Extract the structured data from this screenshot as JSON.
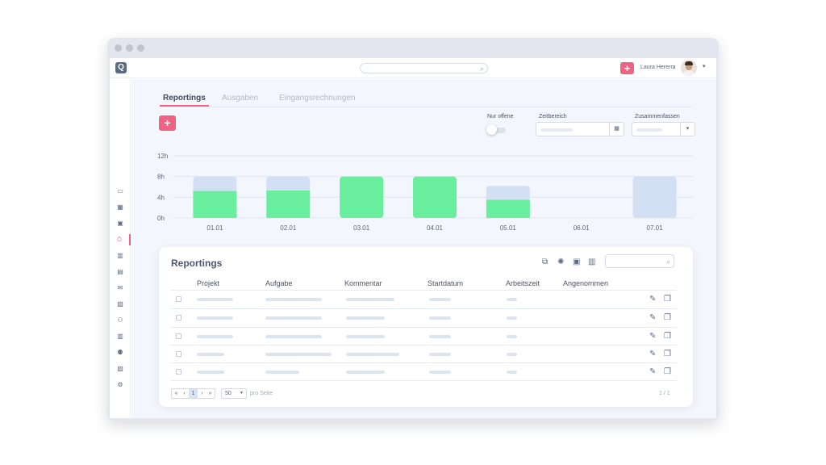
{
  "header": {
    "user_name": "Laura Hererra",
    "add_label": "+",
    "logo_label": "Q"
  },
  "tabs": [
    {
      "label": "Reportings",
      "active": true
    },
    {
      "label": "Ausgaben",
      "active": false
    },
    {
      "label": "Eingangsrechnungen",
      "active": false
    }
  ],
  "toolbar": {
    "add_label": "+",
    "filter_open_label": "Nur offene",
    "period_label": "Zeitbereich",
    "group_label": "Zusammenfassen"
  },
  "chart_data": {
    "type": "bar",
    "categories": [
      "01.01",
      "02.01",
      "03.01",
      "04.01",
      "05.01",
      "06.01",
      "07.01"
    ],
    "series": [
      {
        "values": [
          5.2,
          5.3,
          8.0,
          8.0,
          3.5,
          0,
          0
        ]
      },
      {
        "values": [
          2.8,
          2.7,
          0,
          0,
          2.7,
          0,
          8.0
        ]
      }
    ],
    "yticks": [
      "0h",
      "4h",
      "8h",
      "12h"
    ],
    "ylim": [
      0,
      12
    ],
    "stacked": true,
    "colors": {
      "done": "#69ee9e",
      "open": "#d3e0f4"
    },
    "grid": true
  },
  "table": {
    "title": "Reportings",
    "columns": [
      "Projekt",
      "Aufgabe",
      "Kommentar",
      "Startdatum",
      "Arbeitszeit",
      "Angenommen"
    ],
    "per_page": "50",
    "per_page_label": "pro Seite",
    "page_info": "1 / 1",
    "pager": [
      "«",
      "‹",
      "1",
      "›",
      "»"
    ]
  },
  "colors": {
    "accent": "#f06283",
    "background": "#f3f6fc"
  }
}
